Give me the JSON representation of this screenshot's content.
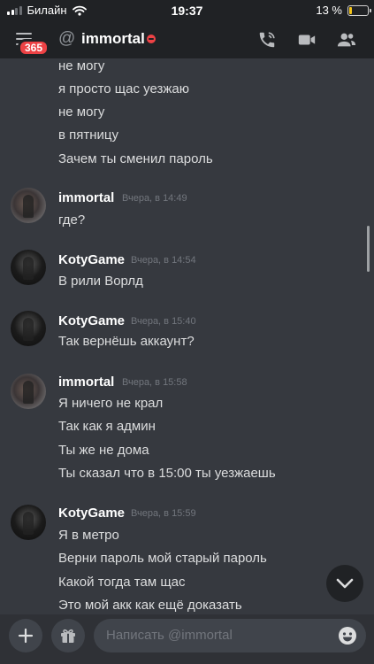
{
  "status_bar": {
    "carrier": "Билайн",
    "time": "19:37",
    "battery_text": "13 %",
    "battery_level": 0.13
  },
  "header": {
    "unread_badge": "365",
    "channel_name": "immortal",
    "at_symbol": "@"
  },
  "messages": {
    "cont_lines": [
      "не могу",
      "я просто щас уезжаю",
      "не могу",
      "в пятницу",
      "Зачем ты сменил пароль"
    ],
    "groups": [
      {
        "author": "immortal",
        "timestamp": "Вчера, в 14:49",
        "lines": [
          "где?"
        ]
      },
      {
        "author": "KotyGame",
        "timestamp": "Вчера, в 14:54",
        "lines": [
          "В рили Ворлд"
        ]
      },
      {
        "author": "KotyGame",
        "timestamp": "Вчера, в 15:40",
        "lines": [
          "Так вернёшь аккаунт?"
        ]
      },
      {
        "author": "immortal",
        "timestamp": "Вчера, в 15:58",
        "lines": [
          "Я ничего не крал",
          "Так как я админ",
          "Ты же не дома",
          "Ты сказал что в 15:00 ты уезжаешь"
        ]
      },
      {
        "author": "KotyGame",
        "timestamp": "Вчера, в 15:59",
        "lines": [
          "Я в метро",
          "Верни пароль мой старый пароль",
          "Какой тогда там щас",
          "Это мой акк как ещё доказать"
        ]
      }
    ]
  },
  "composer": {
    "placeholder": "Написать @immortal"
  },
  "colors": {
    "background": "#36393f",
    "header": "#202225",
    "composer": "#2f3136",
    "input": "#40444b",
    "badge": "#ed4245",
    "battery": "#f5c518",
    "status_dnd": "#ed4245"
  },
  "icons": [
    "wifi-icon",
    "hamburger-menu-icon",
    "at-icon",
    "dnd-status-icon",
    "phone-call-icon",
    "video-camera-icon",
    "members-icon",
    "chevron-down-icon",
    "plus-icon",
    "gift-icon",
    "emoji-icon"
  ]
}
